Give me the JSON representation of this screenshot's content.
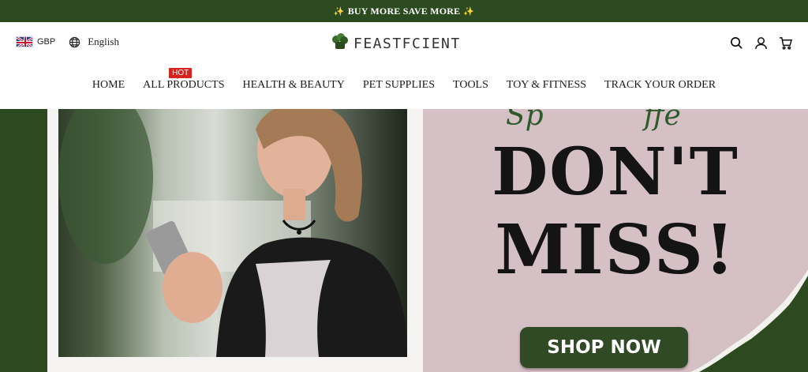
{
  "announcement": {
    "text": "BUY MORE SAVE MORE",
    "spark_left": "✨",
    "spark_right": "✨"
  },
  "header": {
    "currency": "GBP",
    "language": "English",
    "logo_text": "FEASTFCIENT",
    "icons": [
      "search-icon",
      "account-icon",
      "cart-icon"
    ]
  },
  "nav": {
    "items": [
      {
        "label": "HOME"
      },
      {
        "label": "ALL PRODUCTS",
        "badge": "HOT"
      },
      {
        "label": "HEALTH & BEAUTY"
      },
      {
        "label": "PET SUPPLIES"
      },
      {
        "label": "TOOLS"
      },
      {
        "label": "TOY & FITNESS"
      },
      {
        "label": "TRACK YOUR ORDER"
      }
    ]
  },
  "banner": {
    "headline_line1": "DON'T",
    "headline_line2": "MISS!",
    "cta_label": "SHOP NOW"
  },
  "colors": {
    "brand_green": "#2c4a1f",
    "panel_pink": "#d5c1c5",
    "hot_red": "#d6241c"
  }
}
